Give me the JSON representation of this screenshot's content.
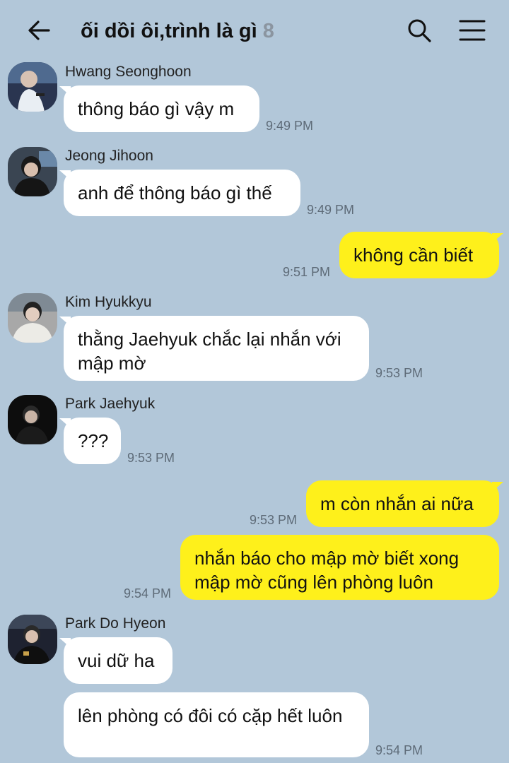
{
  "header": {
    "back_icon": "arrow-left-icon",
    "title": "ối dồi ôi,trình là gì",
    "member_count": "8",
    "search_icon": "search-icon",
    "menu_icon": "hamburger-menu-icon"
  },
  "colors": {
    "background": "#b2c7d9",
    "incoming_bubble": "#ffffff",
    "outgoing_bubble": "#fef01b",
    "time_text": "#5e6b78",
    "member_count": "#8b95a0"
  },
  "messages": [
    {
      "direction": "in",
      "sender": "Hwang Seonghoon",
      "text": "thông báo gì vậy m",
      "time": "9:49 PM"
    },
    {
      "direction": "in",
      "sender": "Jeong Jihoon",
      "text": "anh để thông báo gì thế",
      "time": "9:49 PM"
    },
    {
      "direction": "out",
      "text": "không cần biết",
      "time": "9:51 PM"
    },
    {
      "direction": "in",
      "sender": "Kim Hyukkyu",
      "text": "thằng Jaehyuk chắc lại nhắn với mập mờ",
      "time": "9:53 PM"
    },
    {
      "direction": "in",
      "sender": "Park Jaehyuk",
      "text": "???",
      "time": "9:53 PM"
    },
    {
      "direction": "out",
      "text": "m còn nhắn ai nữa",
      "time": "9:53 PM"
    },
    {
      "direction": "out",
      "text": "nhắn báo cho mập mờ biết xong mập mờ cũng lên phòng luôn",
      "time": "9:54 PM"
    },
    {
      "direction": "in",
      "sender": "Park Do Hyeon",
      "text": "vui dữ ha",
      "time": ""
    },
    {
      "direction": "in",
      "text": "lên phòng có đôi có cặp hết luôn",
      "time": "9:54 PM"
    }
  ]
}
